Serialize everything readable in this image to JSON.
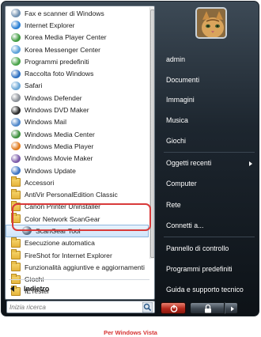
{
  "programs": [
    {
      "label": "Fax e scanner di Windows",
      "icon": "fax-scanner-icon",
      "color": "#6f8fb0"
    },
    {
      "label": "Internet Explorer",
      "icon": "internet-explorer-icon",
      "color": "#2a7fd4"
    },
    {
      "label": "Korea Media Player Center",
      "icon": "media-player-center-icon",
      "color": "#3f9a3f"
    },
    {
      "label": "Korea Messenger Center",
      "icon": "messenger-center-icon",
      "color": "#5aa0d8"
    },
    {
      "label": "Programmi predefiniti",
      "icon": "default-programs-icon",
      "color": "#48a348"
    },
    {
      "label": "Raccolta foto Windows",
      "icon": "photo-gallery-icon",
      "color": "#2e6fc0"
    },
    {
      "label": "Safari",
      "icon": "safari-icon",
      "color": "#6aa6d6"
    },
    {
      "label": "Windows Defender",
      "icon": "windows-defender-icon",
      "color": "#8a8f96"
    },
    {
      "label": "Windows DVD Maker",
      "icon": "dvd-maker-icon",
      "color": "#2a2a2a"
    },
    {
      "label": "Windows Mail",
      "icon": "windows-mail-icon",
      "color": "#4d86c9"
    },
    {
      "label": "Windows Media Center",
      "icon": "windows-media-center-icon",
      "color": "#3d8f3d"
    },
    {
      "label": "Windows Media Player",
      "icon": "windows-media-player-icon",
      "color": "#e07a1d"
    },
    {
      "label": "Windows Movie Maker",
      "icon": "movie-maker-icon",
      "color": "#7a5aa8"
    },
    {
      "label": "Windows Update",
      "icon": "windows-update-icon",
      "color": "#3c74c4"
    },
    {
      "label": "Accessori",
      "icon": "folder-icon",
      "folder": true
    },
    {
      "label": "AntiVir PersonalEdition Classic",
      "icon": "folder-icon",
      "folder": true
    },
    {
      "label": "Canon Printer Uninstaller",
      "icon": "folder-icon",
      "folder": true
    },
    {
      "label": "Color Network ScanGear",
      "icon": "folder-icon",
      "folder": true
    },
    {
      "label": "ScanGear Tool",
      "icon": "scangear-tool-icon",
      "color": "#5a6f86",
      "indent": true,
      "highlight": true
    },
    {
      "label": "Esecuzione automatica",
      "icon": "folder-icon",
      "folder": true
    },
    {
      "label": "FireShot for Internet Explorer",
      "icon": "folder-icon",
      "folder": true
    },
    {
      "label": "Funzionalità aggiuntive e aggiornamenti",
      "icon": "folder-icon",
      "folder": true
    },
    {
      "label": "Giochi",
      "icon": "folder-icon",
      "folder": true
    },
    {
      "label": "IETester",
      "icon": "folder-icon",
      "folder": true
    }
  ],
  "back_label": "Indietro",
  "search": {
    "placeholder": "Inizia ricerca"
  },
  "right_menu": {
    "user": "admin",
    "documents": "Documenti",
    "pictures": "Immagini",
    "music": "Musica",
    "games": "Giochi",
    "recent": "Oggetti recenti",
    "computer": "Computer",
    "network": "Rete",
    "connect": "Connetti a...",
    "control_panel": "Pannello di controllo",
    "default_programs": "Programmi predefiniti",
    "help": "Guida e supporto tecnico"
  },
  "caption": "Per Windows Vista",
  "colors": {
    "highlight_border": "#d83a3a",
    "caption": "#d63232"
  }
}
